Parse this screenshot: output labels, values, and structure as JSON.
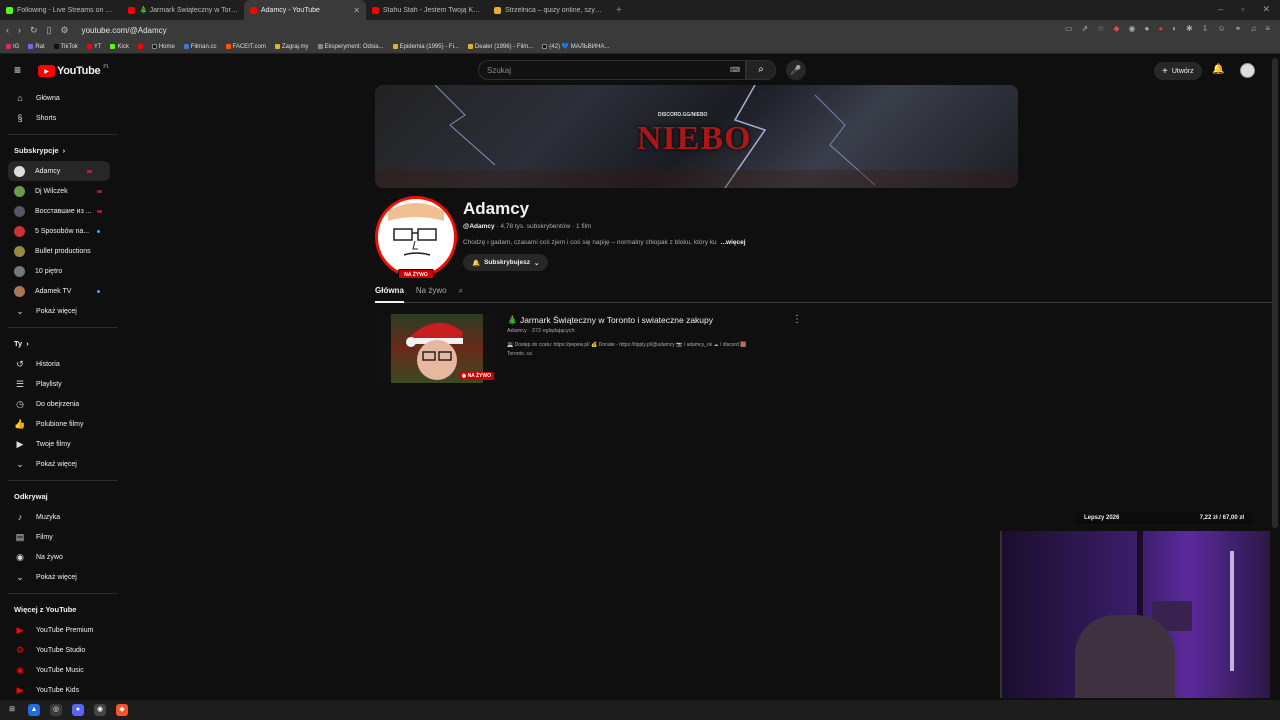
{
  "browser": {
    "tabs": [
      {
        "label": "Following - Live Streams on Kick",
        "color": "#53fc18"
      },
      {
        "label": "🎄 Jarmark Świąteczny w Toronto",
        "color": "#ff0000"
      },
      {
        "label": "Adamcy - YouTube",
        "color": "#ff0000",
        "active": true
      },
      {
        "label": "Stahu Stah - Jestem Twoją Kokaina",
        "color": "#ff0000"
      },
      {
        "label": "Strzelnica – quizy online, szybka gra",
        "color": "#e0b030"
      }
    ],
    "url": "youtube.com/@Adamcy",
    "bookmarks": [
      {
        "label": "IG",
        "color": "#d62976"
      },
      {
        "label": "Rat",
        "color": "#8a5cf6"
      },
      {
        "label": "TikTok",
        "color": "#000000"
      },
      {
        "label": "YT",
        "color": "#ff0000"
      },
      {
        "label": "Kick",
        "color": "#53fc18"
      },
      {
        "label": "",
        "color": "#ff0000"
      },
      {
        "label": "Home",
        "color": "#000000"
      },
      {
        "label": "Filman.cc",
        "color": "#3a7bd5"
      },
      {
        "label": "FACEIT.com",
        "color": "#ff5500"
      },
      {
        "label": "Zagraj.my",
        "color": "#e0b030"
      },
      {
        "label": "Eksperyment: Odsia...",
        "color": "#888888"
      },
      {
        "label": "Epidemia (1995) - Fi...",
        "color": "#e0b030"
      },
      {
        "label": "Dealer (1996) - Film...",
        "color": "#e0b030"
      },
      {
        "label": "(42) 💙 МАЛЬВИНА...",
        "color": "#000000"
      }
    ]
  },
  "header": {
    "logo": "YouTube",
    "logo_region": "PL",
    "search_placeholder": "Szukaj",
    "create_label": "Utwórz"
  },
  "sidebar": {
    "main": [
      {
        "label": "Główna",
        "icon": "home-icon"
      },
      {
        "label": "Shorts",
        "icon": "shorts-icon"
      }
    ],
    "subs_title": "Subskrypcje",
    "subs": [
      {
        "label": "Adamcy",
        "color": "#dddddd"
      },
      {
        "label": "Dj Wilczek",
        "color": "#6a9a4a"
      },
      {
        "label": "Восставшие из ...",
        "color": "#556"
      },
      {
        "label": "5 Sposobów na...",
        "color": "#cc3333"
      },
      {
        "label": "Bullet productions",
        "color": "#998844"
      },
      {
        "label": "10 piętro",
        "color": "#777777"
      },
      {
        "label": "Adamek TV",
        "color": "#aa7755"
      }
    ],
    "subs_more": "Pokaż więcej",
    "you_title": "Ty",
    "you": [
      {
        "label": "Historia",
        "icon": "history-icon"
      },
      {
        "label": "Playlisty",
        "icon": "playlist-icon"
      },
      {
        "label": "Do obejrzenia",
        "icon": "clock-icon"
      },
      {
        "label": "Polubione filmy",
        "icon": "thumbs-up-icon"
      },
      {
        "label": "Twoje filmy",
        "icon": "video-icon"
      }
    ],
    "you_more": "Pokaż więcej",
    "explore_title": "Odkrywaj",
    "explore": [
      {
        "label": "Muzyka",
        "icon": "music-icon"
      },
      {
        "label": "Filmy",
        "icon": "film-icon"
      },
      {
        "label": "Na żywo",
        "icon": "live-icon"
      }
    ],
    "explore_more": "Pokaż więcej",
    "more_title": "Więcej z YouTube",
    "more": [
      {
        "label": "YouTube Premium"
      },
      {
        "label": "YouTube Studio"
      },
      {
        "label": "YouTube Music"
      },
      {
        "label": "YouTube Kids"
      }
    ]
  },
  "channel": {
    "banner_text": "NIEBO",
    "banner_sub": "DISCORD.GG/NIEBO",
    "live_badge": "NA ŻYWO",
    "name": "Adamcy",
    "handle": "@Adamcy",
    "subscribers": "4,78 tys. subskrybentów",
    "video_count": "1 film",
    "description": "Chodzę i gadam, czasami coś zjem i coś się napiję – normalny chłopak z bloku, który ku",
    "description_more": "...więcej",
    "subscribe_label": "Subskrybujesz",
    "tabs": [
      "Główna",
      "Na żywo"
    ]
  },
  "live_video": {
    "title": "🎄 Jarmark Świąteczny w Toronto i swiateczne zakupy",
    "channel": "Adamcy",
    "watchers": "372 oglądających",
    "desc_line1": "💻 Dostęp do czatu: https://pepew.pl/ 💰 Donate - https://tipply.pl/@adamcy 📷 / adamcy_ok ☁ / discord 🟫",
    "desc_line2": "Toronto, ca",
    "badge": "NA ŻYWO"
  },
  "overlay": {
    "goal_label": "Lepszy 2026",
    "goal_value": "7,22 zł / 67,00 zł"
  }
}
